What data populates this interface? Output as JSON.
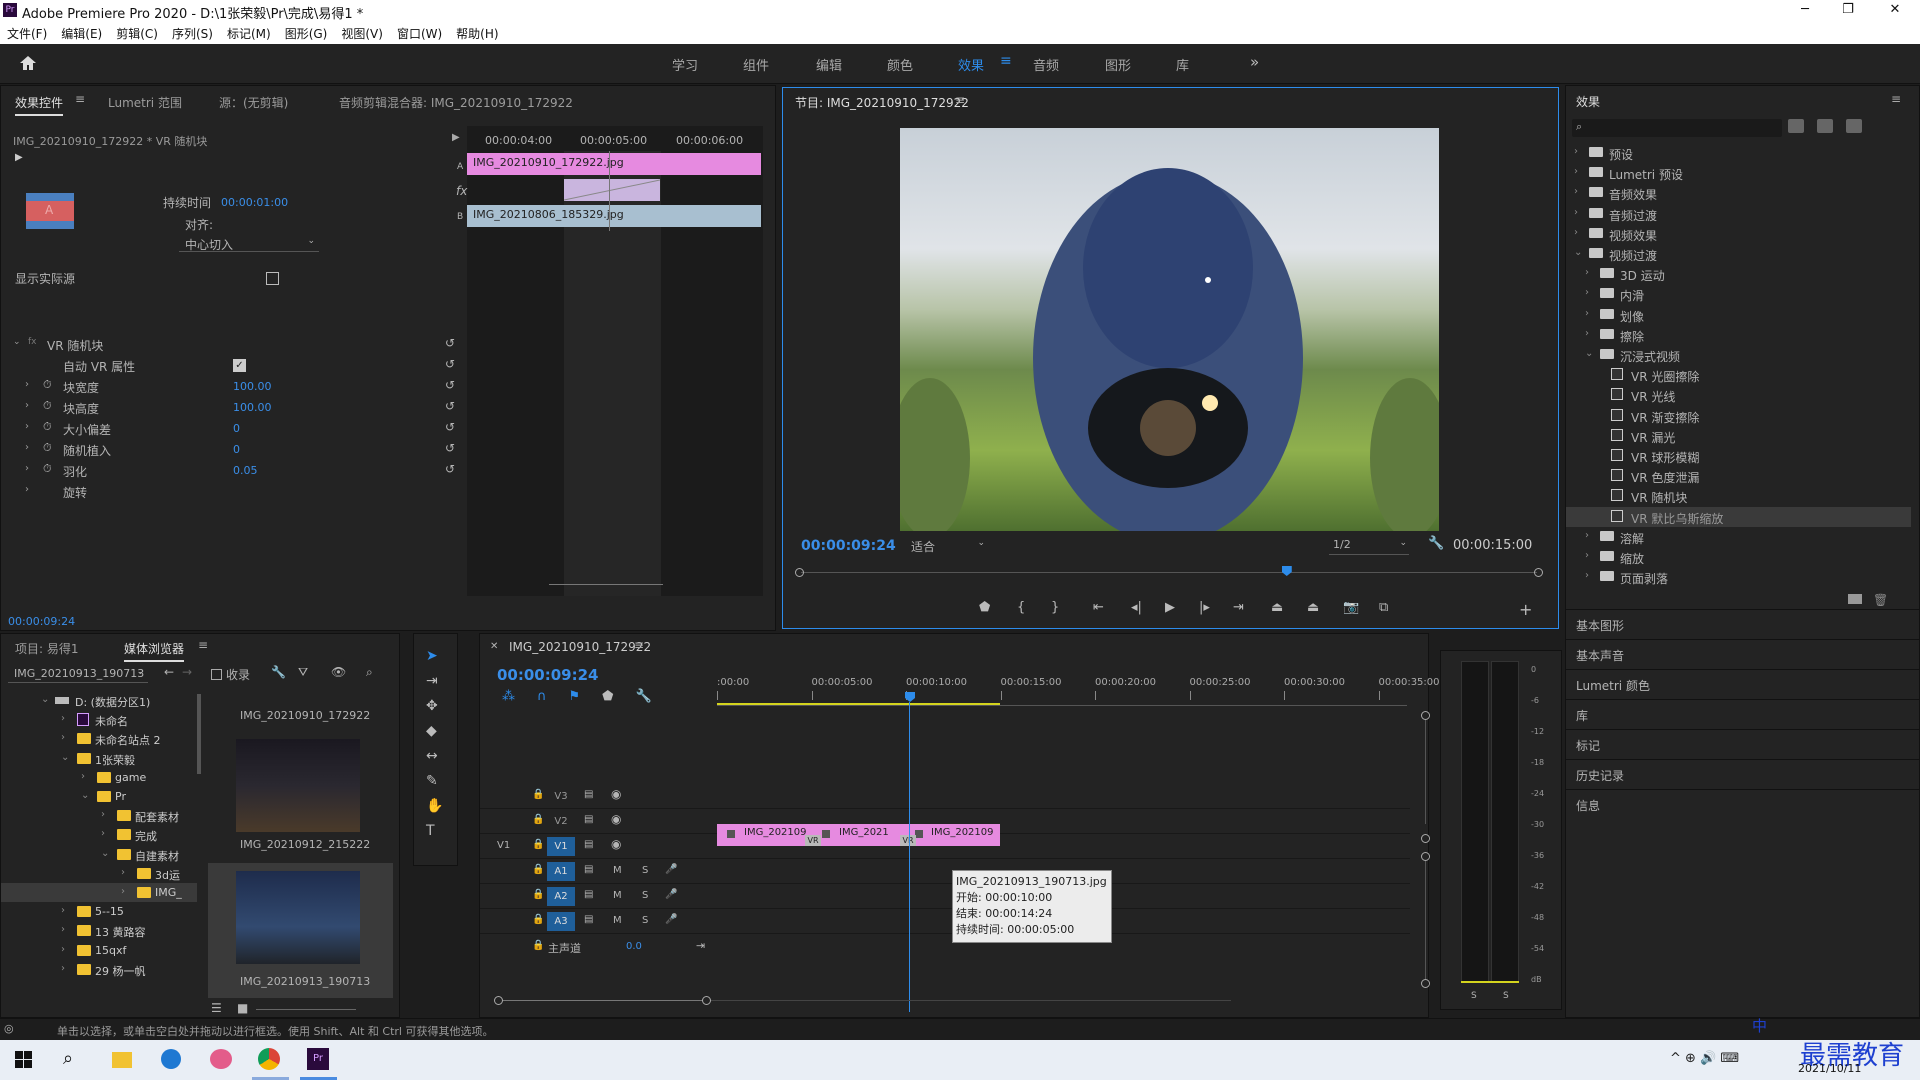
{
  "window": {
    "title": "Adobe Premiere Pro 2020 - D:\\1张荣毅\\Pr\\完成\\易得1 *",
    "app_icon": "Pr",
    "controls": [
      "─",
      "❐",
      "✕"
    ]
  },
  "menu": [
    "文件(F)",
    "编辑(E)",
    "剪辑(C)",
    "序列(S)",
    "标记(M)",
    "图形(G)",
    "视图(V)",
    "窗口(W)",
    "帮助(H)"
  ],
  "workspaces": [
    "学习",
    "组件",
    "编辑",
    "颜色",
    "效果",
    "音频",
    "图形",
    "库"
  ],
  "active_workspace": "效果",
  "effect_controls": {
    "tabs": [
      "效果控件",
      "Lumetri 范围",
      "源：(无剪辑)",
      "音频剪辑混合器: IMG_20210910_172922"
    ],
    "clip_label": "IMG_20210910_172922 * VR 随机块",
    "duration_label": "持续时间",
    "duration_value": "00:00:01:00",
    "align_label": "对齐:",
    "align_value": "中心切入",
    "show_source": "显示实际源",
    "timecodes": [
      "00:00:04:00",
      "00:00:05:00",
      "00:00:06:00"
    ],
    "clip_a": "IMG_20210910_172922.jpg",
    "clip_b": "IMG_20210806_185329.jpg",
    "label_a": "A",
    "label_b": "B",
    "fx": "fx",
    "effect_name": "VR 随机块",
    "params": [
      {
        "name": "自动 VR 属性",
        "value": "",
        "checkbox": true
      },
      {
        "name": "块宽度",
        "value": "100.00"
      },
      {
        "name": "块高度",
        "value": "100.00"
      },
      {
        "name": "大小偏差",
        "value": "0"
      },
      {
        "name": "随机植入",
        "value": "0"
      },
      {
        "name": "羽化",
        "value": "0.05"
      },
      {
        "name": "旋转",
        "value": ""
      }
    ],
    "footer_time": "00:00:09:24"
  },
  "program": {
    "title": "节目: IMG_20210910_172922",
    "timecode": "00:00:09:24",
    "fit": "适合",
    "quality": "1/2",
    "duration": "00:00:15:00",
    "playhead_fraction": 0.66
  },
  "effects_panel": {
    "title": "效果",
    "search_placeholder": "",
    "tree": [
      {
        "label": "预设",
        "depth": 0,
        "type": "folder",
        "open": false
      },
      {
        "label": "Lumetri 预设",
        "depth": 0,
        "type": "folder",
        "open": false
      },
      {
        "label": "音频效果",
        "depth": 0,
        "type": "folder",
        "open": false
      },
      {
        "label": "音频过渡",
        "depth": 0,
        "type": "folder",
        "open": false
      },
      {
        "label": "视频效果",
        "depth": 0,
        "type": "folder",
        "open": false
      },
      {
        "label": "视频过渡",
        "depth": 0,
        "type": "folder",
        "open": true
      },
      {
        "label": "3D 运动",
        "depth": 1,
        "type": "folder",
        "open": false
      },
      {
        "label": "内滑",
        "depth": 1,
        "type": "folder",
        "open": false
      },
      {
        "label": "划像",
        "depth": 1,
        "type": "folder",
        "open": false
      },
      {
        "label": "擦除",
        "depth": 1,
        "type": "folder",
        "open": false
      },
      {
        "label": "沉浸式视频",
        "depth": 1,
        "type": "folder",
        "open": true
      },
      {
        "label": "VR 光圈擦除",
        "depth": 2,
        "type": "item"
      },
      {
        "label": "VR 光线",
        "depth": 2,
        "type": "item"
      },
      {
        "label": "VR 渐变擦除",
        "depth": 2,
        "type": "item"
      },
      {
        "label": "VR 漏光",
        "depth": 2,
        "type": "item"
      },
      {
        "label": "VR 球形模糊",
        "depth": 2,
        "type": "item"
      },
      {
        "label": "VR 色度泄漏",
        "depth": 2,
        "type": "item"
      },
      {
        "label": "VR 随机块",
        "depth": 2,
        "type": "item"
      },
      {
        "label": "VR 默比乌斯缩放",
        "depth": 2,
        "type": "item",
        "selected": true
      },
      {
        "label": "溶解",
        "depth": 1,
        "type": "folder",
        "open": false
      },
      {
        "label": "缩放",
        "depth": 1,
        "type": "folder",
        "open": false
      },
      {
        "label": "页面剥落",
        "depth": 1,
        "type": "folder",
        "open": false
      }
    ],
    "sections": [
      "基本图形",
      "基本声音",
      "Lumetri 颜色",
      "库",
      "标记",
      "历史记录",
      "信息"
    ]
  },
  "project": {
    "tabs": [
      "项目: 易得1",
      "媒体浏览器"
    ],
    "path": "IMG_20210913_190713",
    "ingest": "收录",
    "tree": [
      {
        "label": "D: (数据分区1)",
        "depth": 0,
        "icon": "drive",
        "open": true
      },
      {
        "label": "未命名",
        "depth": 1,
        "icon": "pr"
      },
      {
        "label": "未命名站点 2",
        "depth": 1,
        "icon": "folder"
      },
      {
        "label": "1张荣毅",
        "depth": 1,
        "icon": "folder",
        "open": true
      },
      {
        "label": "game",
        "depth": 2,
        "icon": "folder"
      },
      {
        "label": "Pr",
        "depth": 2,
        "icon": "folder",
        "open": true
      },
      {
        "label": "配套素材",
        "depth": 3,
        "icon": "folder"
      },
      {
        "label": "完成",
        "depth": 3,
        "icon": "folder"
      },
      {
        "label": "自建素材",
        "depth": 3,
        "icon": "folder",
        "open": true
      },
      {
        "label": "3d运",
        "depth": 4,
        "icon": "folder"
      },
      {
        "label": "IMG_",
        "depth": 4,
        "icon": "folder",
        "selected": true
      },
      {
        "label": "5--15",
        "depth": 1,
        "icon": "folder"
      },
      {
        "label": "13 黄路容",
        "depth": 1,
        "icon": "folder"
      },
      {
        "label": "15qxf",
        "depth": 1,
        "icon": "folder"
      },
      {
        "label": "29 杨一帆",
        "depth": 1,
        "icon": "folder"
      }
    ],
    "thumbs": [
      "IMG_20210910_172922",
      "IMG_20210912_215222",
      "IMG_20210913_190713"
    ]
  },
  "timeline": {
    "title": "IMG_20210910_172922",
    "timecode": "00:00:09:24",
    "ruler": [
      ":00:00",
      "00:00:05:00",
      "00:00:10:00",
      "00:00:15:00",
      "00:00:20:00",
      "00:00:25:00",
      "00:00:30:00",
      "00:00:35:00"
    ],
    "video_tracks": [
      "V3",
      "V2",
      "V1"
    ],
    "audio_tracks": [
      "A1",
      "A2",
      "A3"
    ],
    "master": "主声道",
    "master_value": "0.0",
    "source_patch_v": "V1",
    "clips": [
      "IMG_202109",
      "IMG_2021",
      "IMG_202109"
    ],
    "vr_label": "VR",
    "m": "M",
    "s": "S",
    "tooltip": {
      "name": "IMG_20210913_190713.jpg",
      "start": "开始: 00:00:10:00",
      "end": "结束: 00:00:14:24",
      "duration": "持续时间: 00:00:05:00"
    }
  },
  "meter": {
    "scale": [
      "0",
      "-6",
      "-12",
      "-18",
      "-24",
      "-30",
      "-36",
      "-42",
      "-48",
      "-54",
      "dB"
    ],
    "buttons": [
      "S",
      "S"
    ]
  },
  "status": "单击以选择，或单击空白处并拖动以进行框选。使用 Shift、Alt 和 Ctrl 可获得其他选项。",
  "taskbar": {
    "date": "2021/10/11",
    "watermark": "最需教育",
    "ime": "中"
  },
  "colors": {
    "accent": "#2d8ceb",
    "clip_pink": "#e68ae0",
    "clip_blue": "#a8bfd0",
    "track_blue": "#1f5f9a"
  }
}
